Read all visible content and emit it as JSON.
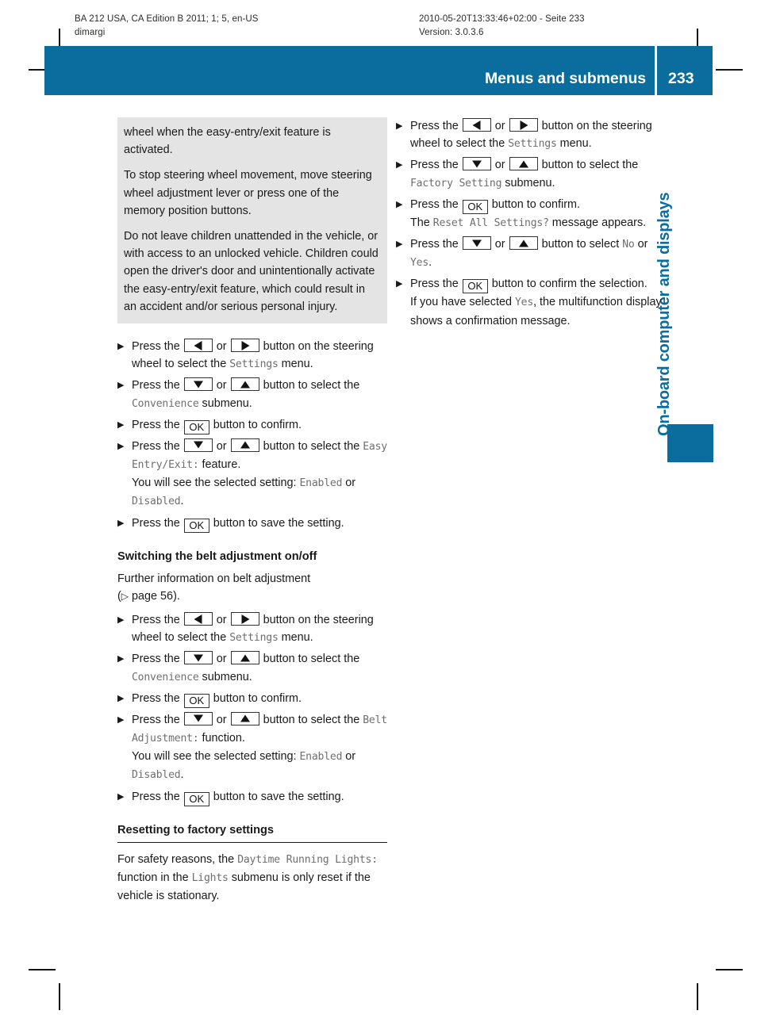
{
  "slug": {
    "left_line1": "BA 212 USA, CA Edition B 2011; 1; 5, en-US",
    "left_line2": "dimargi",
    "right_line1": "2010-05-20T13:33:46+02:00 - Seite 233",
    "right_line2": "Version: 3.0.3.6"
  },
  "header": {
    "title": "Menus and submenus",
    "page_number": "233",
    "accent_color": "#0a6d9e"
  },
  "chapter_tab": {
    "label": "On-board computer and displays"
  },
  "left_column": {
    "warning_box": {
      "paragraphs": [
        "wheel when the easy-entry/exit feature is activated.",
        "To stop steering wheel movement, move steering wheel adjustment lever or press one of the memory position buttons.",
        "Do not leave children unattended in the vehicle, or with access to an unlocked vehicle. Children could open the driver's door and unintentionally activate the easy-entry/exit feature, which could result in an accident and/or serious personal injury."
      ]
    },
    "steps_easy_entry": [
      {
        "parts": [
          {
            "t": "text",
            "v": "Press the "
          },
          {
            "t": "key",
            "v": "left"
          },
          {
            "t": "text",
            "v": " or "
          },
          {
            "t": "key",
            "v": "right"
          },
          {
            "t": "text",
            "v": " button on the steering wheel to select the "
          },
          {
            "t": "disp",
            "v": "Settings"
          },
          {
            "t": "text",
            "v": " menu."
          }
        ]
      },
      {
        "parts": [
          {
            "t": "text",
            "v": "Press the "
          },
          {
            "t": "key",
            "v": "down"
          },
          {
            "t": "text",
            "v": " or "
          },
          {
            "t": "key",
            "v": "up"
          },
          {
            "t": "text",
            "v": " button to select the "
          },
          {
            "t": "disp",
            "v": "Convenience"
          },
          {
            "t": "text",
            "v": " submenu."
          }
        ]
      },
      {
        "parts": [
          {
            "t": "text",
            "v": "Press the "
          },
          {
            "t": "key",
            "v": "ok"
          },
          {
            "t": "text",
            "v": " button to confirm."
          }
        ]
      },
      {
        "parts": [
          {
            "t": "text",
            "v": "Press the "
          },
          {
            "t": "key",
            "v": "down"
          },
          {
            "t": "text",
            "v": " or "
          },
          {
            "t": "key",
            "v": "up"
          },
          {
            "t": "text",
            "v": " button to select the "
          },
          {
            "t": "disp",
            "v": "Easy Entry/Exit:"
          },
          {
            "t": "text",
            "v": " feature."
          },
          {
            "t": "br"
          },
          {
            "t": "text",
            "v": "You will see the selected setting: "
          },
          {
            "t": "disp",
            "v": "Enabled"
          },
          {
            "t": "text",
            "v": " or "
          },
          {
            "t": "disp",
            "v": "Disabled"
          },
          {
            "t": "text",
            "v": "."
          }
        ]
      },
      {
        "parts": [
          {
            "t": "text",
            "v": "Press the "
          },
          {
            "t": "key",
            "v": "ok"
          },
          {
            "t": "text",
            "v": " button to save the setting."
          }
        ]
      }
    ],
    "belt_heading": "Switching the belt adjustment on/off",
    "belt_intro_before": "Further information on belt adjustment",
    "belt_intro_xref": "page 56",
    "steps_belt": [
      {
        "parts": [
          {
            "t": "text",
            "v": "Press the "
          },
          {
            "t": "key",
            "v": "left"
          },
          {
            "t": "text",
            "v": " or "
          },
          {
            "t": "key",
            "v": "right"
          },
          {
            "t": "text",
            "v": " button on the steering wheel to select the "
          },
          {
            "t": "disp",
            "v": "Settings"
          },
          {
            "t": "text",
            "v": " menu."
          }
        ]
      },
      {
        "parts": [
          {
            "t": "text",
            "v": "Press the "
          },
          {
            "t": "key",
            "v": "down"
          },
          {
            "t": "text",
            "v": " or "
          },
          {
            "t": "key",
            "v": "up"
          },
          {
            "t": "text",
            "v": " button to select the "
          },
          {
            "t": "disp",
            "v": "Convenience"
          },
          {
            "t": "text",
            "v": " submenu."
          }
        ]
      },
      {
        "parts": [
          {
            "t": "text",
            "v": "Press the "
          },
          {
            "t": "key",
            "v": "ok"
          },
          {
            "t": "text",
            "v": " button to confirm."
          }
        ]
      },
      {
        "parts": [
          {
            "t": "text",
            "v": "Press the "
          },
          {
            "t": "key",
            "v": "down"
          },
          {
            "t": "text",
            "v": " or "
          },
          {
            "t": "key",
            "v": "up"
          },
          {
            "t": "text",
            "v": " button to select the "
          },
          {
            "t": "disp",
            "v": "Belt Adjustment:"
          },
          {
            "t": "text",
            "v": " function."
          },
          {
            "t": "br"
          },
          {
            "t": "text",
            "v": "You will see the selected setting: "
          },
          {
            "t": "disp",
            "v": "Enabled"
          },
          {
            "t": "text",
            "v": " or "
          },
          {
            "t": "disp",
            "v": "Disabled"
          },
          {
            "t": "text",
            "v": "."
          }
        ]
      },
      {
        "parts": [
          {
            "t": "text",
            "v": "Press the "
          },
          {
            "t": "key",
            "v": "ok"
          },
          {
            "t": "text",
            "v": " button to save the setting."
          }
        ]
      }
    ],
    "reset_heading": "Resetting to factory settings",
    "reset_paragraph": [
      {
        "t": "text",
        "v": "For safety reasons, the "
      },
      {
        "t": "disp",
        "v": "Daytime Running Lights:"
      },
      {
        "t": "text",
        "v": " function in the "
      },
      {
        "t": "disp",
        "v": "Lights"
      },
      {
        "t": "text",
        "v": " submenu is only reset if the vehicle is stationary."
      }
    ]
  },
  "right_column": {
    "steps_reset": [
      {
        "parts": [
          {
            "t": "text",
            "v": "Press the "
          },
          {
            "t": "key",
            "v": "left"
          },
          {
            "t": "text",
            "v": " or "
          },
          {
            "t": "key",
            "v": "right"
          },
          {
            "t": "text",
            "v": " button on the steering wheel to select the "
          },
          {
            "t": "disp",
            "v": "Settings"
          },
          {
            "t": "text",
            "v": " menu."
          }
        ]
      },
      {
        "parts": [
          {
            "t": "text",
            "v": "Press the "
          },
          {
            "t": "key",
            "v": "down"
          },
          {
            "t": "text",
            "v": " or "
          },
          {
            "t": "key",
            "v": "up"
          },
          {
            "t": "text",
            "v": " button to select the "
          },
          {
            "t": "disp",
            "v": "Factory Setting"
          },
          {
            "t": "text",
            "v": " submenu."
          }
        ]
      },
      {
        "parts": [
          {
            "t": "text",
            "v": "Press the "
          },
          {
            "t": "key",
            "v": "ok"
          },
          {
            "t": "text",
            "v": " button to confirm."
          },
          {
            "t": "br"
          },
          {
            "t": "text",
            "v": "The "
          },
          {
            "t": "disp",
            "v": "Reset All Settings?"
          },
          {
            "t": "text",
            "v": " message appears."
          }
        ]
      },
      {
        "parts": [
          {
            "t": "text",
            "v": "Press the "
          },
          {
            "t": "key",
            "v": "down"
          },
          {
            "t": "text",
            "v": " or "
          },
          {
            "t": "key",
            "v": "up"
          },
          {
            "t": "text",
            "v": " button to select "
          },
          {
            "t": "disp",
            "v": "No"
          },
          {
            "t": "text",
            "v": " or "
          },
          {
            "t": "disp",
            "v": "Yes"
          },
          {
            "t": "text",
            "v": "."
          }
        ]
      },
      {
        "parts": [
          {
            "t": "text",
            "v": "Press the "
          },
          {
            "t": "key",
            "v": "ok"
          },
          {
            "t": "text",
            "v": " button to confirm the selection."
          },
          {
            "t": "br"
          },
          {
            "t": "text",
            "v": "If you have selected "
          },
          {
            "t": "disp",
            "v": "Yes"
          },
          {
            "t": "text",
            "v": ", the multifunction display shows a confirmation message."
          }
        ]
      }
    ]
  },
  "glyphs": {
    "step_marker": "▶",
    "xref_marker": "▷",
    "ok_label": "OK"
  }
}
